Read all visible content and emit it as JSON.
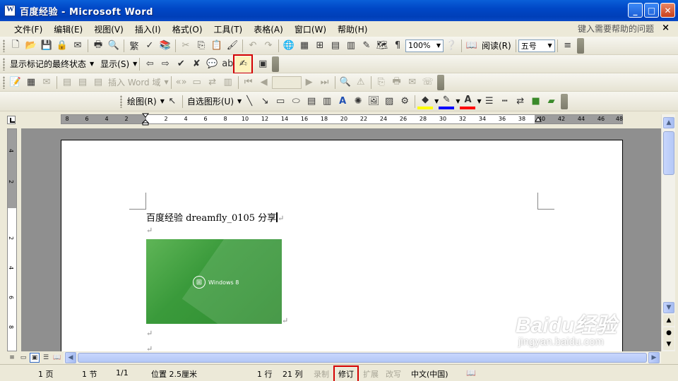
{
  "window": {
    "title": "百度经验 - Microsoft Word",
    "minimize": "_",
    "maximize": "□",
    "close": "✕"
  },
  "menubar": {
    "items": [
      "文件(F)",
      "编辑(E)",
      "视图(V)",
      "插入(I)",
      "格式(O)",
      "工具(T)",
      "表格(A)",
      "窗口(W)",
      "帮助(H)"
    ],
    "help_placeholder": "键入需要帮助的问题",
    "close": "×"
  },
  "toolbar1": {
    "zoom": "100%",
    "read_label": "阅读(R)",
    "font_size": "五号"
  },
  "toolbar2": {
    "markup_display": "显示标记的最终状态",
    "show_label": "显示(S)"
  },
  "toolbar3": {
    "insert_word_field": "插入 Word 域"
  },
  "toolbar4": {
    "draw_label": "绘图(R)",
    "autoshapes_label": "自选图形(U)",
    "fill_color": "#ffff00",
    "line_color": "#0000ff",
    "font_color": "#ff0000"
  },
  "ruler": {
    "h_ticks": [
      "8",
      "6",
      "4",
      "2",
      "2",
      "4",
      "6",
      "8",
      "10",
      "12",
      "14",
      "16",
      "18",
      "20",
      "22",
      "24",
      "26",
      "28",
      "30",
      "32",
      "34",
      "36",
      "38",
      "40",
      "42",
      "44",
      "46",
      "48"
    ],
    "v_ticks": [
      "4",
      "2",
      "2",
      "4",
      "6",
      "8"
    ]
  },
  "document": {
    "line1": "百度经验  dreamfly_0105 分享",
    "image_caption": "Windows 8",
    "para_mark": "↵"
  },
  "statusbar": {
    "page": "1 页",
    "section": "1 节",
    "page_of": "1/1",
    "position": "位置 2.5厘米",
    "line": "1 行",
    "column": "21 列",
    "record": "录制",
    "track_changes": "修订",
    "extend": "扩展",
    "overtype": "改写",
    "language": "中文(中国)"
  },
  "watermark": {
    "brand": "Baidu经验",
    "url": "jingyan.baidu.com"
  }
}
